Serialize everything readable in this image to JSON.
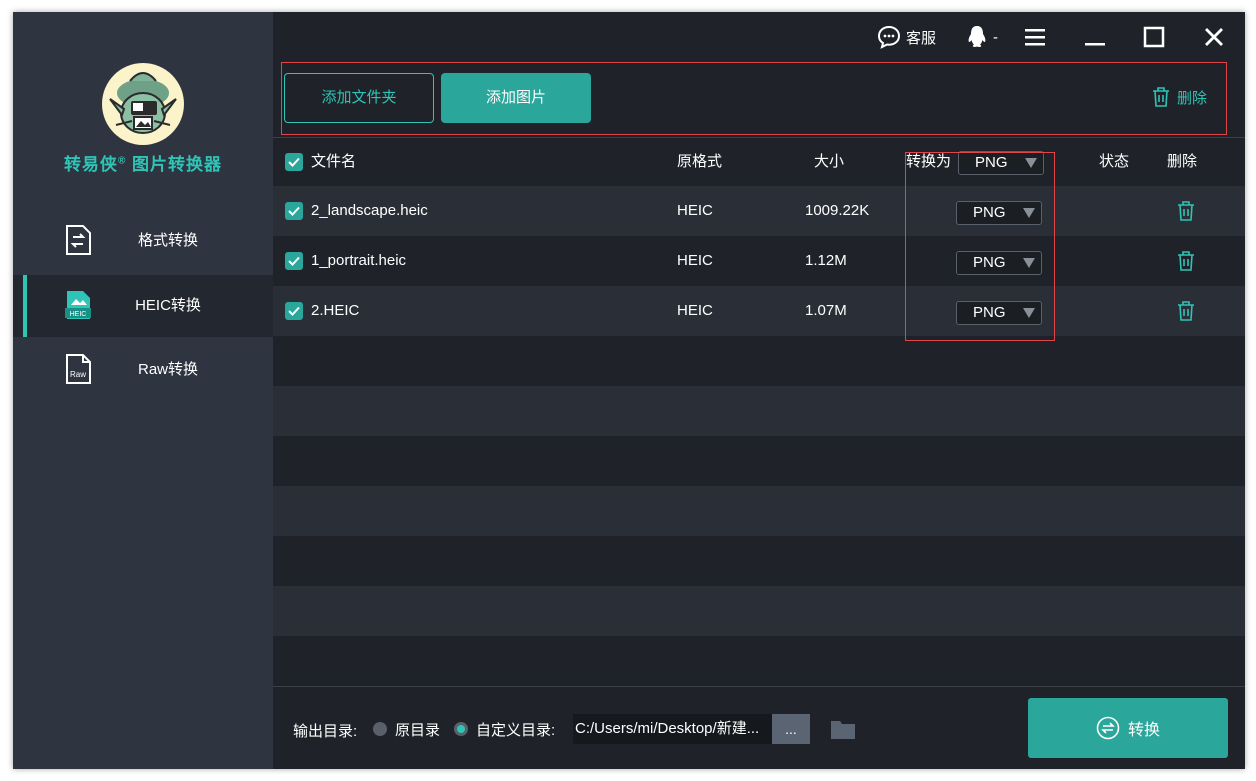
{
  "app": {
    "name": "转易侠",
    "trademark": "®",
    "subtitle": "图片转换器"
  },
  "sidebar": {
    "items": [
      {
        "label": "格式转换",
        "icon": "format-convert-icon",
        "active": false
      },
      {
        "label": "HEIC转换",
        "icon": "heic-file-icon",
        "active": true
      },
      {
        "label": "Raw转换",
        "icon": "raw-file-icon",
        "active": false
      }
    ],
    "heic_badge": "HEIC",
    "raw_badge": "Raw"
  },
  "titlebar": {
    "support_label": "客服",
    "qq_label": "-"
  },
  "toolbar": {
    "add_folder_label": "添加文件夹",
    "add_image_label": "添加图片",
    "delete_label": "删除"
  },
  "table": {
    "headers": {
      "filename": "文件名",
      "format": "原格式",
      "size": "大小",
      "convert_to": "转换为",
      "status": "状态",
      "delete": "删除"
    },
    "global_format": "PNG",
    "rows": [
      {
        "filename": "2_landscape.heic",
        "format": "HEIC",
        "size": "1009.22K",
        "target": "PNG",
        "status": ""
      },
      {
        "filename": "1_portrait.heic",
        "format": "HEIC",
        "size": "1.12M",
        "target": "PNG",
        "status": ""
      },
      {
        "filename": "2.HEIC",
        "format": "HEIC",
        "size": "1.07M",
        "target": "PNG",
        "status": ""
      }
    ]
  },
  "footer": {
    "output_label": "输出目录:",
    "original_dir_label": "原目录",
    "custom_dir_label": "自定义目录:",
    "path_value": "C:/Users/mi/Desktop/新建...",
    "browse_label": "...",
    "convert_label": "转换"
  },
  "colors": {
    "accent": "#2ec4b6",
    "button": "#2aa69b",
    "highlight_box": "#e0454a"
  }
}
